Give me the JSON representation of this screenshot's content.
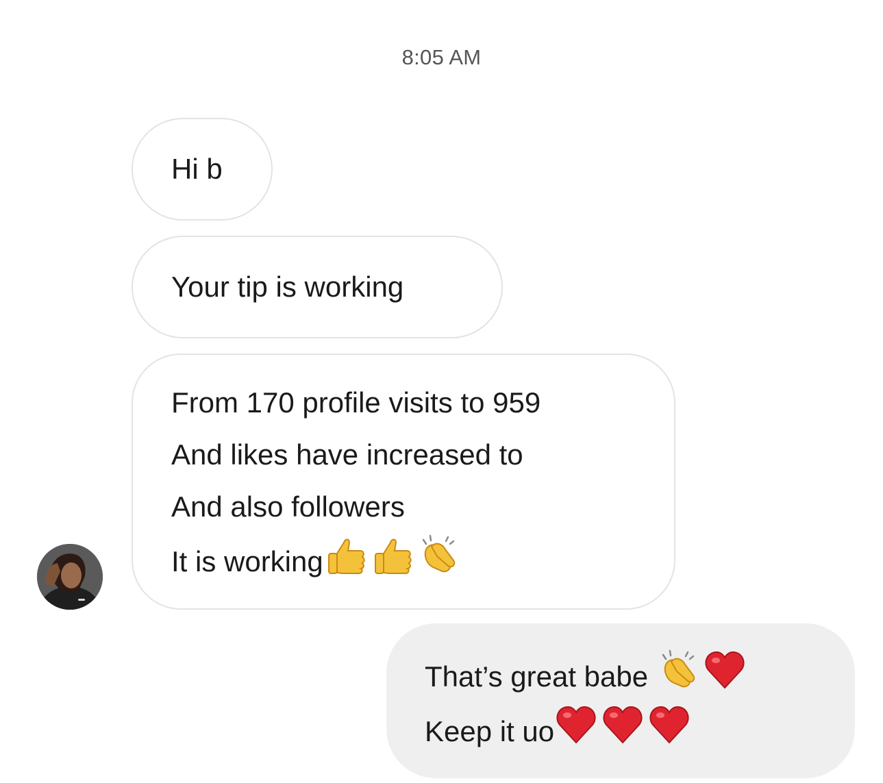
{
  "thread": {
    "timestamp": "8:05 AM"
  },
  "messages": {
    "incoming": [
      {
        "lines": [
          "Hi b"
        ]
      },
      {
        "lines": [
          "Your tip is working"
        ]
      },
      {
        "lines": [
          "From 170 profile visits to 959",
          "And likes have increased to",
          "And also followers",
          "It is working"
        ],
        "trailing_emoji": [
          "thumbs-up-icon",
          "thumbs-up-icon",
          "clapping-hands-icon"
        ]
      }
    ],
    "outgoing": [
      {
        "lines": [
          "That’s great babe",
          "Keep it uo"
        ],
        "line_emoji": [
          [
            "clapping-hands-icon",
            "red-heart-icon"
          ],
          [
            "red-heart-icon",
            "red-heart-icon",
            "red-heart-icon"
          ]
        ]
      }
    ]
  },
  "sender": {
    "avatar_icon": "profile-photo-avatar"
  },
  "colors": {
    "incoming_bubble_bg": "#ffffff",
    "incoming_bubble_border": "#e3e3e3",
    "outgoing_bubble_bg": "#efefef",
    "text": "#1a1a1a",
    "timestamp": "#555555",
    "heart": "#e0242f",
    "emoji_yellow": "#f4c23a"
  }
}
